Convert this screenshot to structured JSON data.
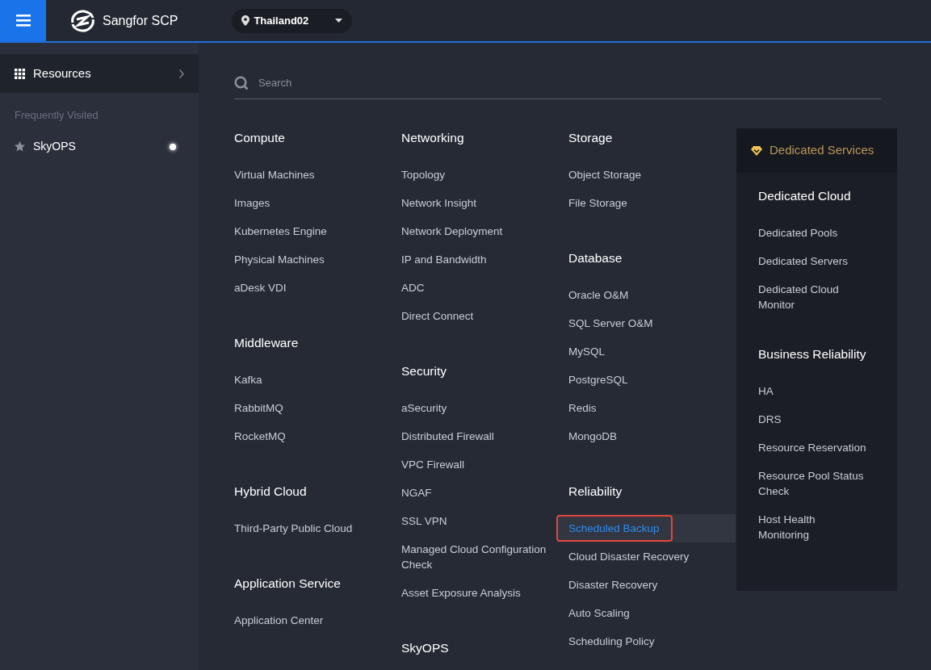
{
  "top_bar": {
    "app_title": "Sangfor SCP",
    "region": "Thailand02"
  },
  "sidebar": {
    "items": [
      {
        "label": "Resources",
        "selected": true
      }
    ],
    "frequently_visited": {
      "title": "Frequently Visited",
      "items": [
        {
          "label": "SkyOPS",
          "dot": true
        }
      ]
    }
  },
  "search": {
    "placeholder": "Search"
  },
  "columns": [
    [
      {
        "title": "Compute",
        "items": [
          {
            "label": "Virtual Machines",
            "selected": false
          },
          {
            "label": "Images",
            "selected": false
          },
          {
            "label": "Kubernetes Engine",
            "selected": false
          },
          {
            "label": "Physical Machines",
            "selected": false
          },
          {
            "label": "aDesk VDI",
            "selected": false
          }
        ]
      },
      {
        "title": "Middleware",
        "items": [
          {
            "label": "Kafka",
            "selected": false
          },
          {
            "label": "RabbitMQ",
            "selected": false
          },
          {
            "label": "RocketMQ",
            "selected": false
          }
        ]
      },
      {
        "title": "Hybrid Cloud",
        "items": [
          {
            "label": "Third-Party Public Cloud",
            "selected": false
          }
        ]
      },
      {
        "title": "Application Service",
        "items": [
          {
            "label": "Application Center",
            "selected": false
          }
        ]
      }
    ],
    [
      {
        "title": "Networking",
        "items": [
          {
            "label": "Topology",
            "selected": false
          },
          {
            "label": "Network Insight",
            "selected": false
          },
          {
            "label": "Network Deployment",
            "selected": false
          },
          {
            "label": "IP and Bandwidth",
            "selected": false
          },
          {
            "label": "ADC",
            "selected": false
          },
          {
            "label": "Direct Connect",
            "selected": false
          }
        ]
      },
      {
        "title": "Security",
        "items": [
          {
            "label": "aSecurity",
            "selected": false
          },
          {
            "label": "Distributed Firewall",
            "selected": false
          },
          {
            "label": "VPC Firewall",
            "selected": false
          },
          {
            "label": "NGAF",
            "selected": false
          },
          {
            "label": "SSL VPN",
            "selected": false
          },
          {
            "label": "Managed Cloud Configuration Check",
            "selected": false
          },
          {
            "label": "Asset Exposure Analysis",
            "selected": false
          }
        ]
      },
      {
        "title": "SkyOPS"
      }
    ],
    [
      {
        "title": "Storage",
        "items": [
          {
            "label": "Object Storage",
            "selected": false
          },
          {
            "label": "File Storage",
            "selected": false
          }
        ]
      },
      {
        "title": "Database",
        "items": [
          {
            "label": "Oracle O&M",
            "selected": false
          },
          {
            "label": "SQL Server O&M",
            "selected": false
          },
          {
            "label": "MySQL",
            "selected": false
          },
          {
            "label": "PostgreSQL",
            "selected": false
          },
          {
            "label": "Redis",
            "selected": false
          },
          {
            "label": "MongoDB",
            "selected": false
          }
        ]
      },
      {
        "title": "Reliability",
        "items": [
          {
            "label": "Scheduled Backup",
            "selected": true
          },
          {
            "label": "Cloud Disaster Recovery",
            "selected": false
          },
          {
            "label": "Disaster Recovery",
            "selected": false
          },
          {
            "label": "Auto Scaling",
            "selected": false
          },
          {
            "label": "Scheduling Policy",
            "selected": false
          }
        ]
      }
    ]
  ],
  "dedicated": {
    "title": "Dedicated Services",
    "groups": [
      {
        "title": "Dedicated Cloud",
        "items": [
          {
            "label": "Dedicated Pools",
            "selected": false
          },
          {
            "label": "Dedicated Servers",
            "selected": false
          },
          {
            "label": "Dedicated Cloud Monitor",
            "selected": false
          }
        ]
      },
      {
        "title": "Business Reliability",
        "items": [
          {
            "label": "HA",
            "selected": false
          },
          {
            "label": "DRS",
            "selected": false
          },
          {
            "label": "Resource Reservation",
            "selected": false
          },
          {
            "label": "Resource Pool Status Check",
            "selected": false
          },
          {
            "label": "Host Health Monitoring",
            "selected": false
          }
        ]
      }
    ]
  }
}
